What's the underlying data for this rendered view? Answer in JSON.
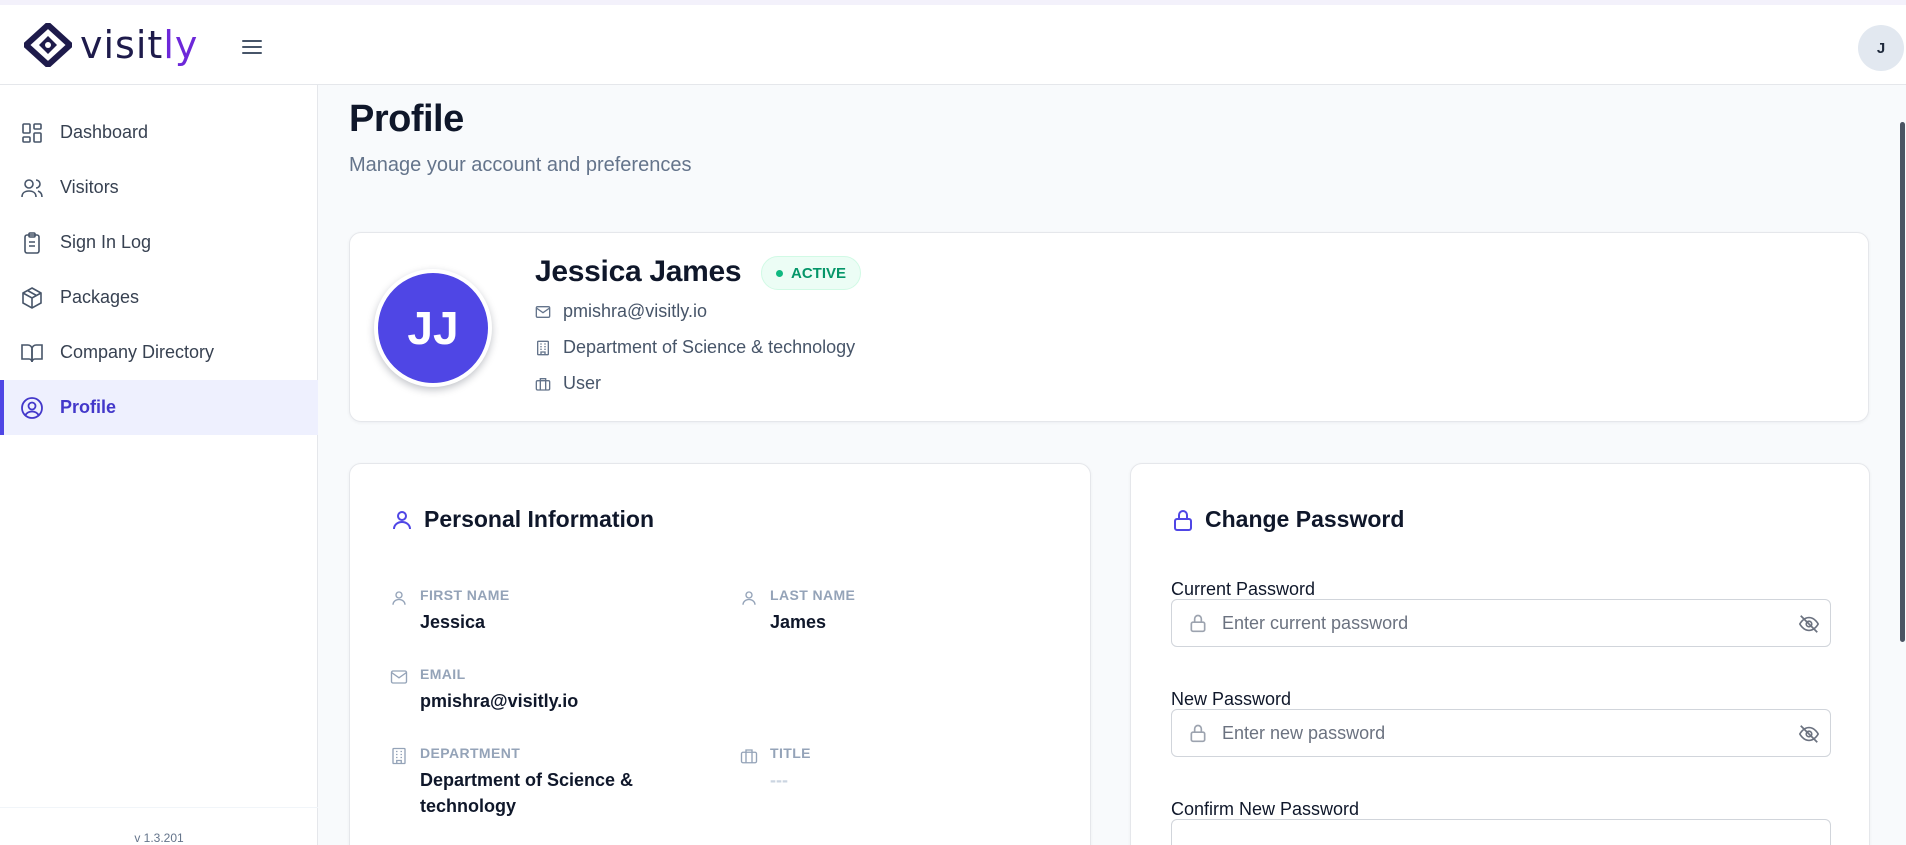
{
  "app": {
    "logo_text_main": "visit",
    "logo_text_accent": "ly",
    "user_initial": "J",
    "version": "v 1.3.201",
    "accent_color": "#4f46e5"
  },
  "sidebar": {
    "items": [
      {
        "label": "Dashboard",
        "icon": "dashboard-icon"
      },
      {
        "label": "Visitors",
        "icon": "users-icon"
      },
      {
        "label": "Sign In Log",
        "icon": "clipboard-icon"
      },
      {
        "label": "Packages",
        "icon": "package-icon"
      },
      {
        "label": "Company Directory",
        "icon": "book-icon"
      },
      {
        "label": "Profile",
        "icon": "user-circle-icon",
        "active": true
      }
    ]
  },
  "page": {
    "title": "Profile",
    "subtitle": "Manage your account and preferences"
  },
  "profile": {
    "initials": "JJ",
    "name": "Jessica James",
    "status": "ACTIVE",
    "email": "pmishra@visitly.io",
    "department": "Department of Science & technology",
    "role": "User"
  },
  "personal_info": {
    "title": "Personal Information",
    "first_name_label": "FIRST NAME",
    "first_name": "Jessica",
    "last_name_label": "LAST NAME",
    "last_name": "James",
    "email_label": "EMAIL",
    "email": "pmishra@visitly.io",
    "department_label": "DEPARTMENT",
    "department": "Department of Science & technology",
    "title_label": "TITLE",
    "title_value": "---"
  },
  "change_password": {
    "title": "Change Password",
    "current_label": "Current Password",
    "current_placeholder": "Enter current password",
    "new_label": "New Password",
    "new_placeholder": "Enter new password",
    "confirm_label": "Confirm New Password"
  }
}
